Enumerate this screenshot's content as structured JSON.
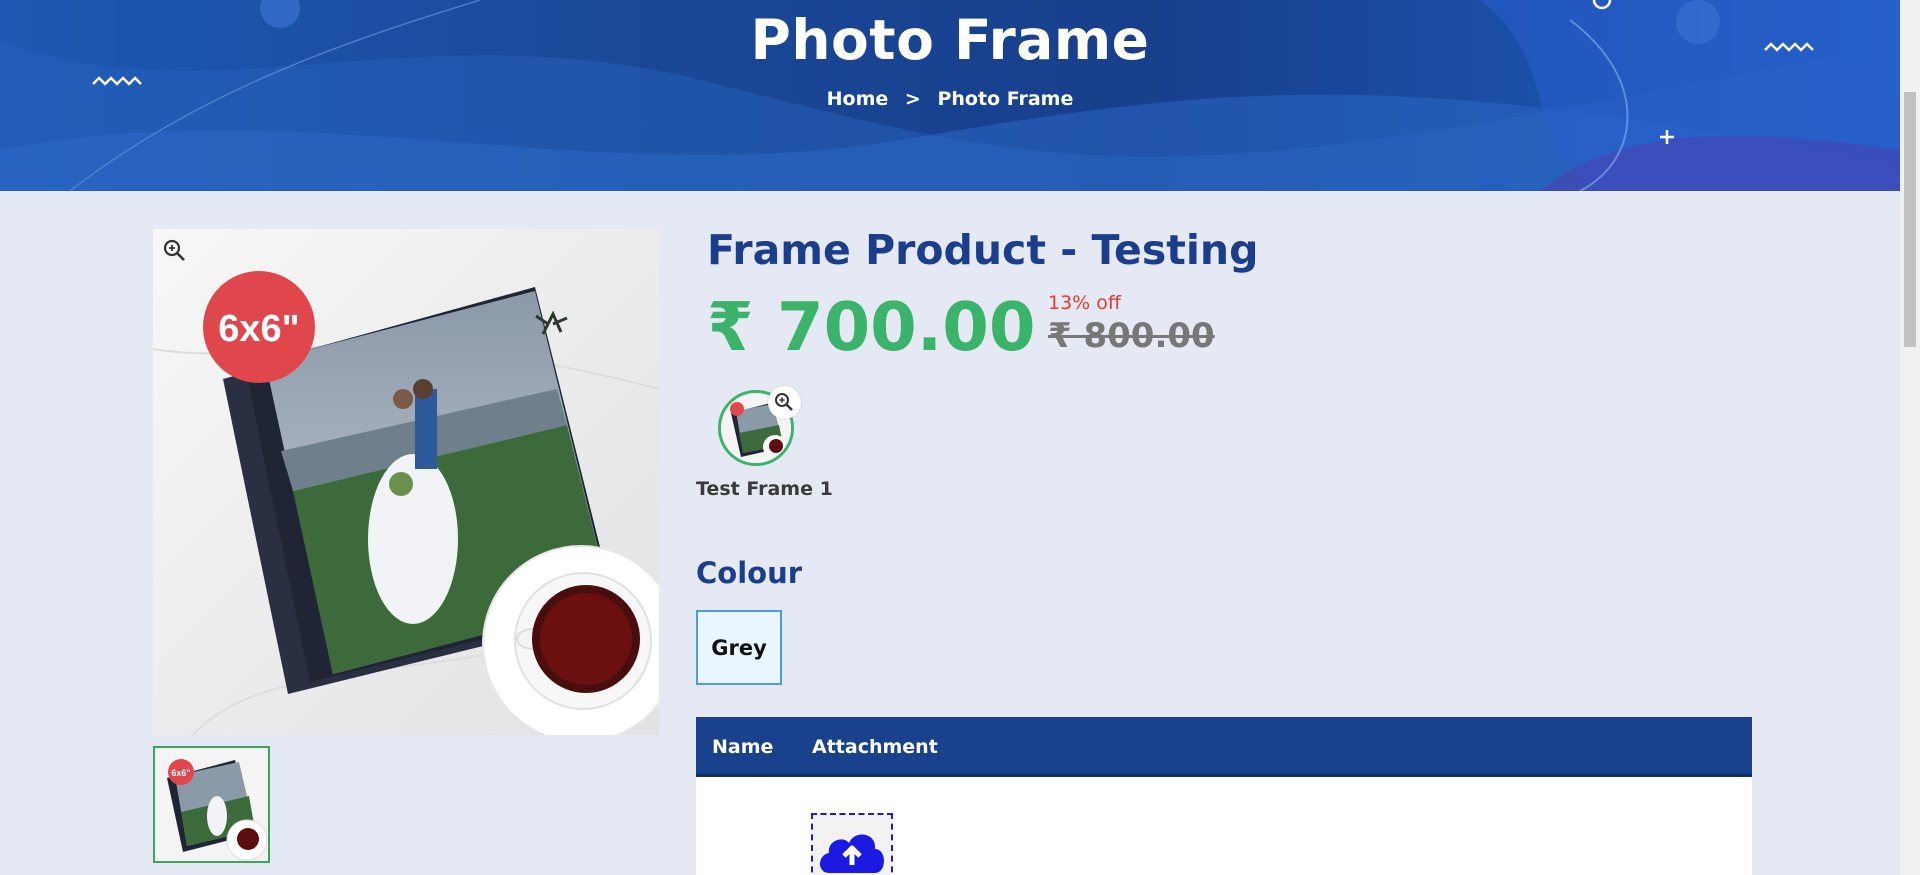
{
  "banner": {
    "title": "Photo Frame",
    "breadcrumb": {
      "home": "Home",
      "separator": ">",
      "current": "Photo Frame"
    }
  },
  "gallery": {
    "badge": "6x6\"",
    "thumb_badge": "6x6\"",
    "zoom_icon": "zoom-in-icon"
  },
  "product": {
    "title": "Frame Product - Testing",
    "price": "₹ 700.00",
    "discount": "13% off",
    "old_price": "₹ 800.00"
  },
  "variants": [
    {
      "label": "Test Frame 1",
      "selected": true
    }
  ],
  "colour": {
    "heading": "Colour",
    "options": [
      {
        "label": "Grey",
        "selected": true
      }
    ]
  },
  "attachments_table": {
    "columns": [
      "Name",
      "Attachment"
    ],
    "upload_icon": "cloud-upload-icon"
  },
  "colors": {
    "banner": "#1a4a9a",
    "heading": "#1a3d8c",
    "price": "#3bb36a",
    "discount": "#e53935",
    "table_header": "#1a418b",
    "badge": "#e0474c"
  }
}
